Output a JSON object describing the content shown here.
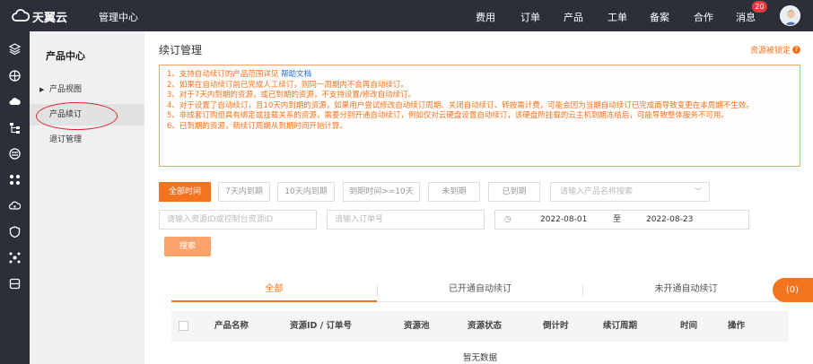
{
  "header": {
    "brand": "天翼云",
    "console_title": "管理中心",
    "nav": [
      "费用",
      "订单",
      "产品",
      "工单",
      "备案",
      "合作",
      "消息"
    ],
    "message_count": "20"
  },
  "sidebar": {
    "title": "产品中心",
    "items": [
      {
        "label": "产品视图"
      },
      {
        "label": "产品续订"
      },
      {
        "label": "退订管理"
      }
    ]
  },
  "main": {
    "title": "续订管理",
    "lock_link": "资源被锁定",
    "notice": {
      "line1_text": "1、支持自动续订的产品范围详见 ",
      "line1_link": "帮助文档",
      "line2": "2、如果在自动续订前已完成人工续订，则同一周期内不会再自动续订。",
      "line3": "3、对于7天内到期的资源，或已到期的资源，不支持设置/修改自动续订。",
      "line4": "4、对于设置了自动续订，且10天内到期的资源，如果用户尝试修改自动续订周期、关闭自动续订、转按需计费，可能会因为当期自动续订已完成而导致变更在本周期不生效。",
      "line5": "5、非成套订购但具有绑定或挂载关系的资源，需要分别开通自动续订，例如仅对云硬盘设置自动续订，该硬盘所挂载的云主机到期冻结后，可能导致整体服务不可用。",
      "line6": "6、已到期的资源，新续订周期从到期时间开始计算。"
    },
    "filters": [
      "全部时间",
      "7天内到期",
      "10天内到期",
      "到期时间>=10天",
      "未到期",
      "已到期"
    ],
    "product_select_placeholder": "请输入产品名称搜索",
    "resource_id_placeholder": "请输入资源ID或控制台资源ID",
    "order_no_placeholder": "请输入订单号",
    "date_start": "2022-08-01",
    "date_sep": "至",
    "date_end": "2022-08-23",
    "search_label": "搜索",
    "tabs": [
      "全部",
      "已开通自动续订",
      "未开通自动续订"
    ],
    "columns": [
      "产品名称",
      "资源ID / 订单号",
      "资源池",
      "资源状态",
      "倒计时",
      "续订周期",
      "时间",
      "操作"
    ],
    "empty_text": "暂无数据",
    "float_count": "(0)"
  },
  "colors": {
    "accent": "#f4731f",
    "topbar": "#2b2f3a",
    "annotation_circle": "#d9262c"
  }
}
